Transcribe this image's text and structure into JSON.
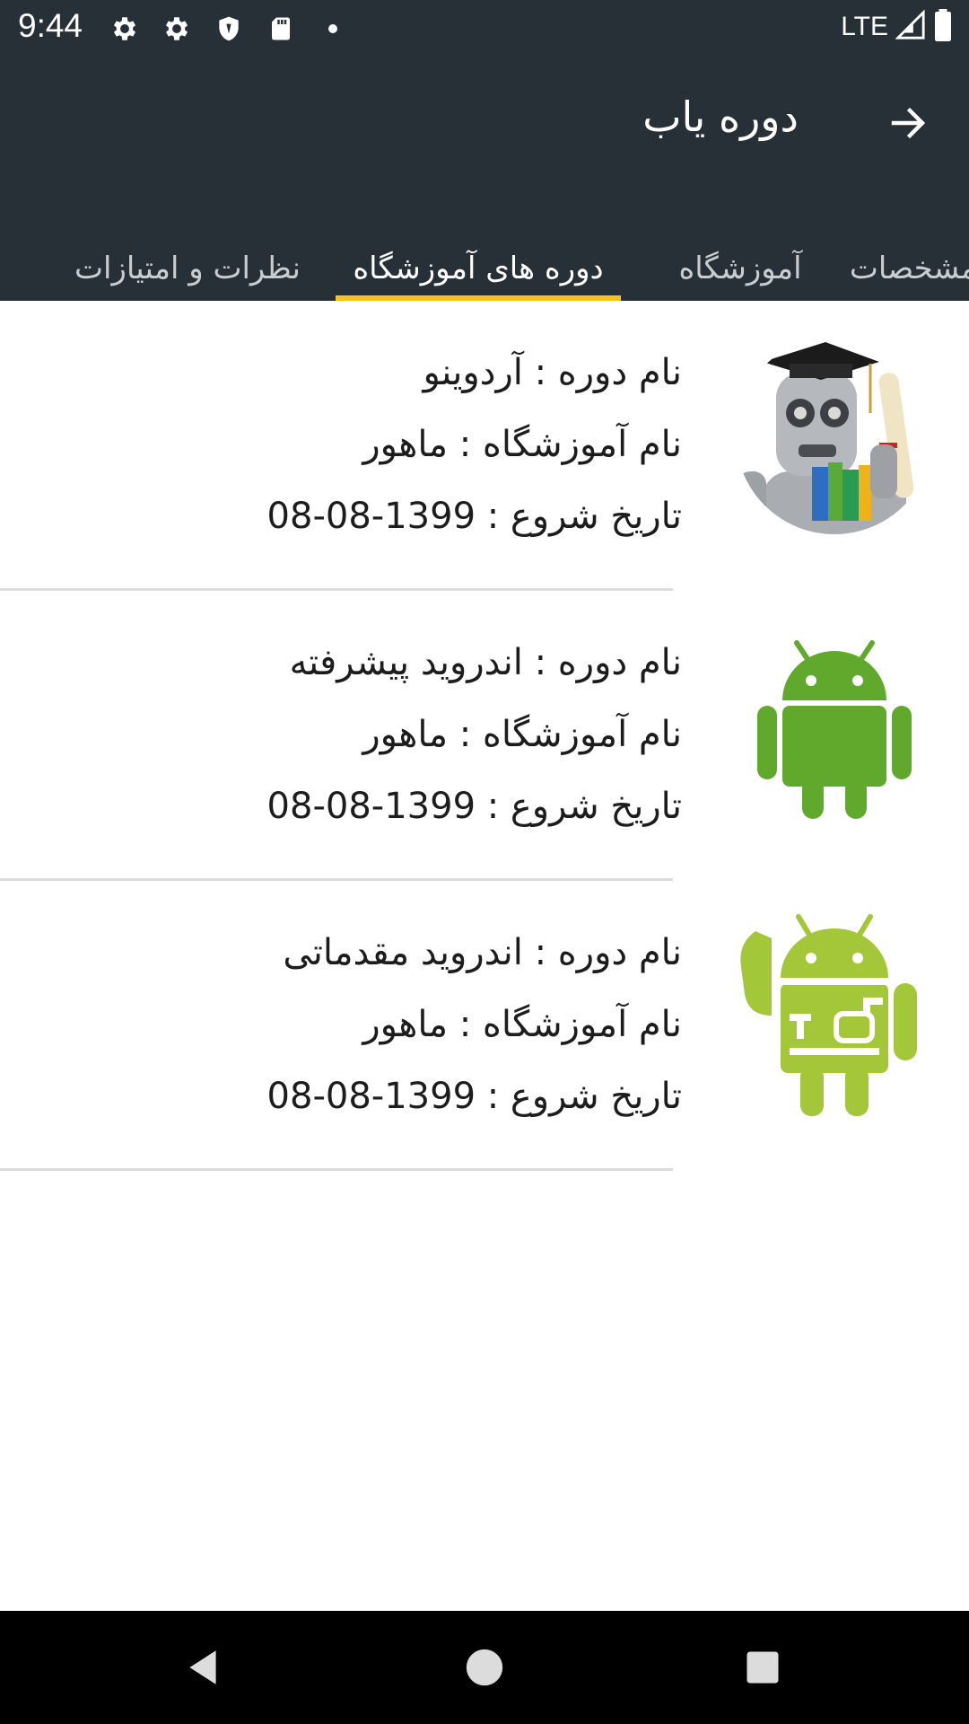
{
  "status_bar": {
    "time": "9:44",
    "network": "LTE",
    "icons": [
      "settings-icon",
      "settings-icon",
      "shield-icon",
      "sd-card-icon",
      "dot-icon",
      "signal-icon",
      "battery-icon"
    ]
  },
  "app_bar": {
    "title": "دوره یاب",
    "back_icon": "arrow-right-icon"
  },
  "tabs": [
    {
      "label": "مشخصات",
      "active": false
    },
    {
      "label": "آموزشگاه",
      "active": false
    },
    {
      "label": "دوره های آموزشگاه",
      "active": true
    },
    {
      "label": "نظرات و امتیازات",
      "active": false
    }
  ],
  "courses": [
    {
      "name": "نام دوره : آردوینو",
      "institute": "نام آموزشگاه : ماهور",
      "start": "تاریخ شروع : 1399-08-08",
      "image": "robot-graduate-image"
    },
    {
      "name": "نام دوره : اندروید پیشرفته",
      "institute": "نام آموزشگاه : ماهور",
      "start": "تاریخ شروع : 1399-08-08",
      "image": "android-robot-image"
    },
    {
      "name": "نام دوره : اندروید مقدماتی",
      "institute": "نام آموزشگاه : ماهور",
      "start": "تاریخ شروع : 1399-08-08",
      "image": "android-tools-image"
    }
  ],
  "colors": {
    "app_bar": "#263036",
    "tab_indicator": "#f7c21b",
    "android_green": "#61a92c",
    "android_light_green": "#a4c639"
  },
  "nav_bar": {
    "buttons": [
      "back-triangle-icon",
      "home-circle-icon",
      "recents-square-icon"
    ]
  }
}
